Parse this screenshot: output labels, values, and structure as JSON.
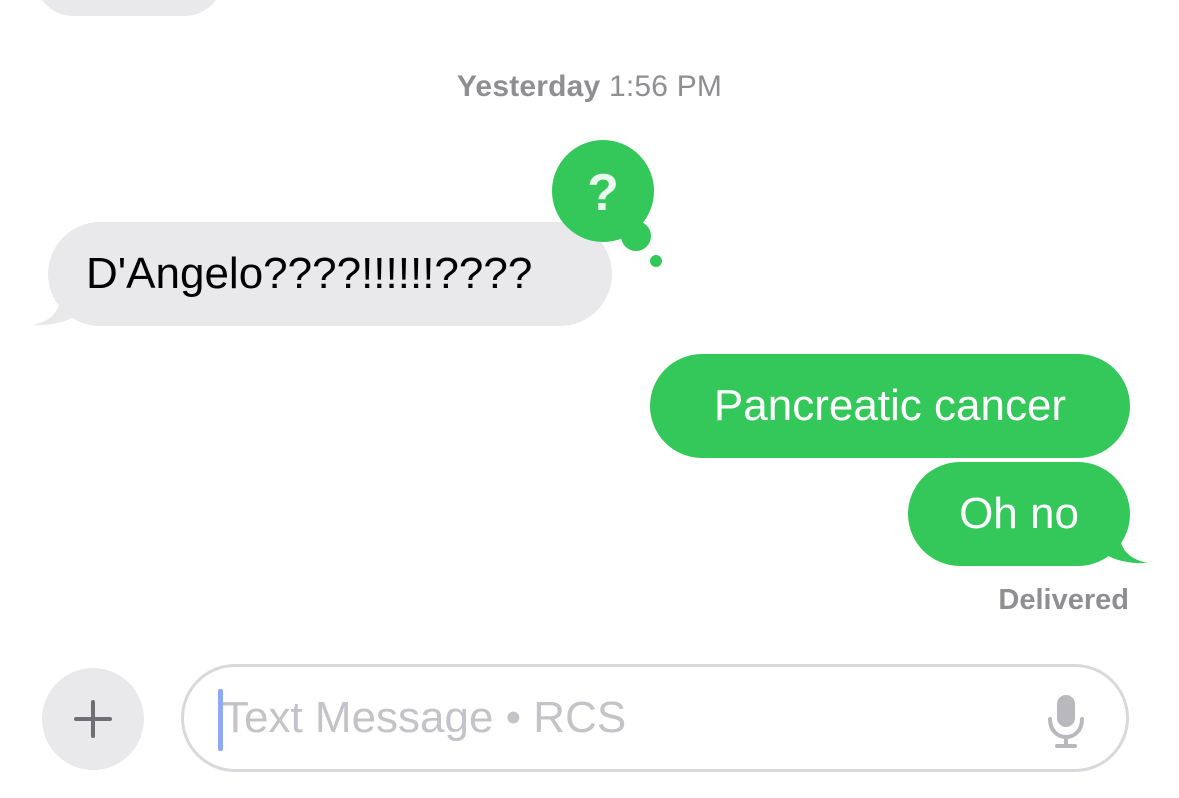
{
  "conversation": {
    "timestamp": {
      "day": "Yesterday",
      "time": "1:56 PM"
    },
    "messages": [
      {
        "direction": "incoming",
        "text": "D'Angelo????!!!!!!????"
      },
      {
        "direction": "outgoing",
        "text": "Pancreatic cancer"
      },
      {
        "direction": "outgoing",
        "text": "Oh no"
      }
    ],
    "reaction": {
      "symbol": "?",
      "icon": "question-mark-icon",
      "color": "#34c759"
    },
    "status": "Delivered"
  },
  "composer": {
    "add_icon": "plus-icon",
    "placeholder": "Text Message • RCS",
    "mic_icon": "microphone-icon"
  },
  "colors": {
    "outgoing_bubble": "#34c759",
    "incoming_bubble": "#e9e9eb",
    "secondary_text": "#8e8e93"
  }
}
